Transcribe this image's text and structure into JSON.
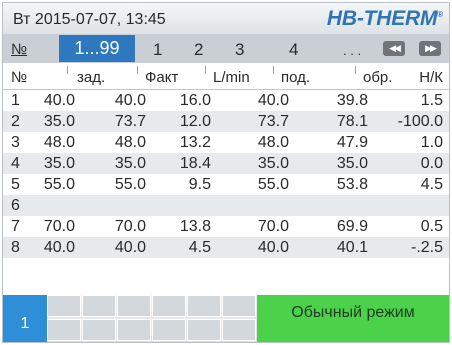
{
  "header": {
    "datetime": "Вт 2015-07-07, 13:45",
    "brand": "HB-THERM",
    "brand_mark": "®"
  },
  "pagebar": {
    "no_label": "№",
    "active_range": "1...99",
    "pages": [
      "1",
      "2",
      "3",
      "4"
    ],
    "more": ". . .",
    "prev_label": "◀◀",
    "next_label": "▶▶"
  },
  "table": {
    "headers": [
      "№",
      "зад.",
      "Факт",
      "L/min",
      "под.",
      "обр.",
      "Н/К"
    ],
    "rows": [
      [
        "1",
        "40.0",
        "40.0",
        "16.0",
        "40.0",
        "39.8",
        "1.5"
      ],
      [
        "2",
        "35.0",
        "73.7",
        "12.0",
        "73.7",
        "78.1",
        "-100.0"
      ],
      [
        "3",
        "48.0",
        "48.0",
        "13.2",
        "48.0",
        "47.9",
        "1.0"
      ],
      [
        "4",
        "35.0",
        "35.0",
        "18.4",
        "35.0",
        "35.0",
        "0.0"
      ],
      [
        "5",
        "55.0",
        "55.0",
        "9.5",
        "55.0",
        "53.8",
        "4.5"
      ],
      [
        "6",
        "",
        "",
        "",
        "",
        "",
        ""
      ],
      [
        "7",
        "70.0",
        "70.0",
        "13.8",
        "70.0",
        "69.9",
        "0.5"
      ],
      [
        "8",
        "40.0",
        "40.0",
        "4.5",
        "40.0",
        "40.1",
        "-.2.5"
      ]
    ]
  },
  "footer": {
    "program_number": "1",
    "mode_label": "Обычный режим"
  },
  "colors": {
    "accent_blue": "#2e78bf",
    "brand_blue": "#2f74b5",
    "mode_green": "#4cd14a"
  }
}
